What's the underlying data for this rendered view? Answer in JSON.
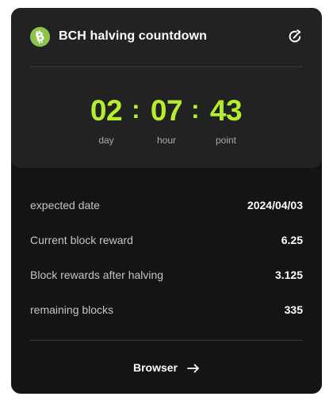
{
  "header": {
    "title": "BCH halving countdown",
    "coin_icon": "bitcoin-cash-icon",
    "refresh_icon": "refresh-icon"
  },
  "countdown": {
    "day": "02",
    "hour": "07",
    "point": "43",
    "separator": ":",
    "day_label": "day",
    "hour_label": "hour",
    "point_label": "point"
  },
  "details": [
    {
      "label": "expected date",
      "value": "2024/04/03"
    },
    {
      "label": "Current block reward",
      "value": "6.25"
    },
    {
      "label": "Block rewards after halving",
      "value": "3.125"
    },
    {
      "label": "remaining blocks",
      "value": "335"
    }
  ],
  "footer": {
    "browser_label": "Browser",
    "arrow_icon": "arrow-right-icon"
  },
  "colors": {
    "accent": "#b5ee2c",
    "bch_green": "#8dc351",
    "card_bg": "#141414",
    "panel_bg": "#222222"
  }
}
